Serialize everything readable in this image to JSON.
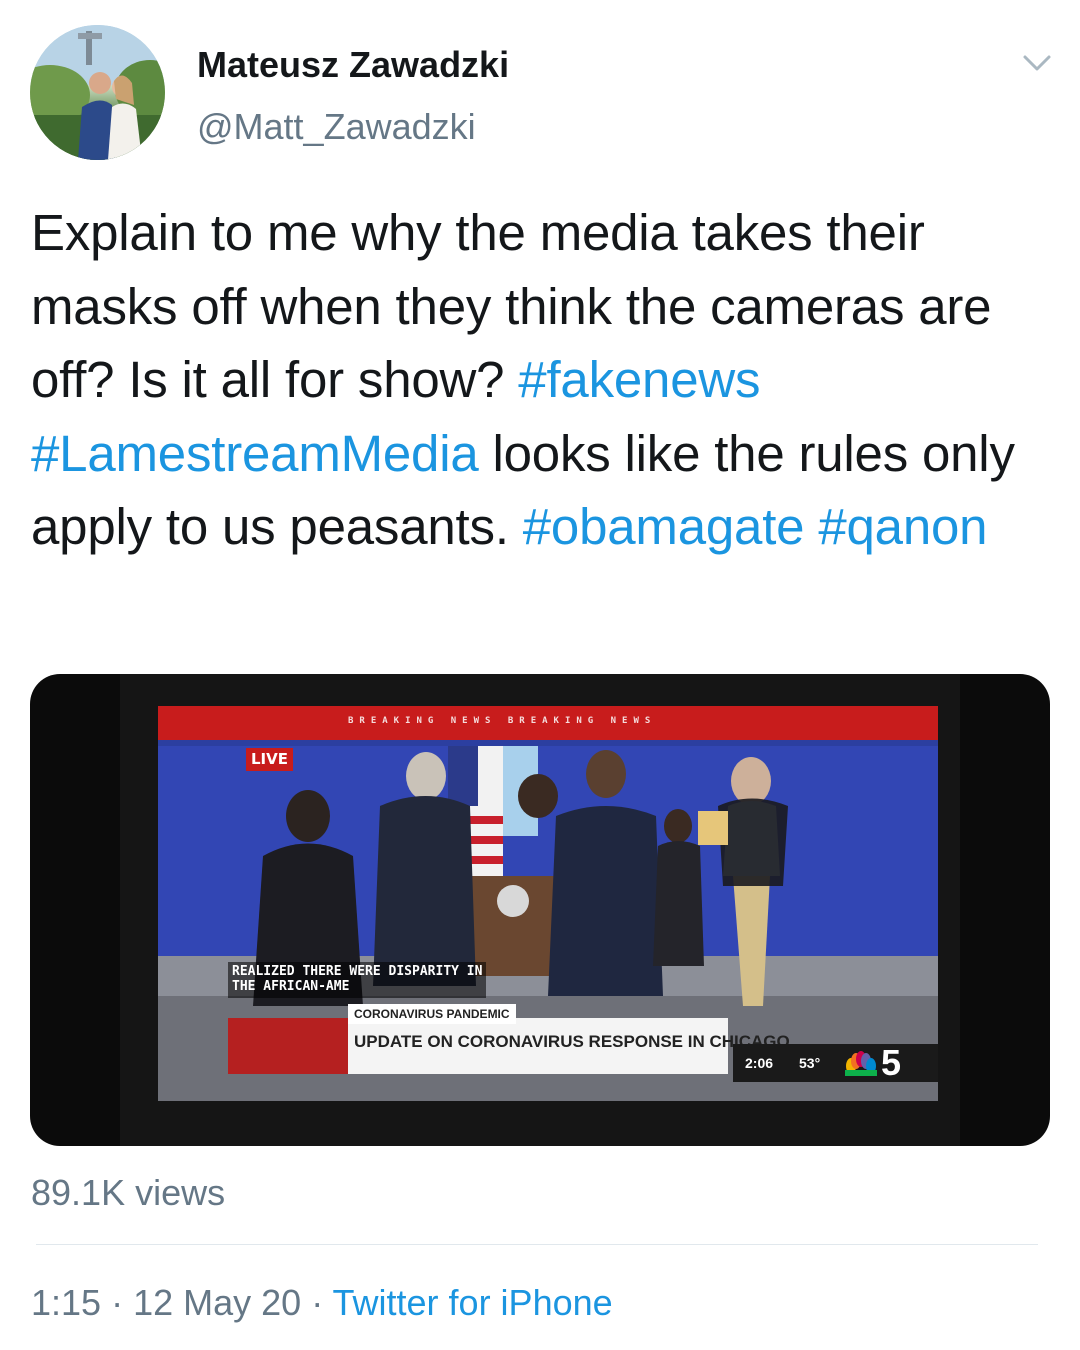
{
  "author": {
    "display_name": "Mateusz Zawadzki",
    "handle": "@Matt_Zawadzki",
    "avatar_icon": "profile-photo-couple"
  },
  "tweet": {
    "segments": [
      {
        "text": "Explain to me why the media takes their masks off when they think the cameras are off? Is it all for show? ",
        "type": "text"
      },
      {
        "text": "#fakenews",
        "type": "hashtag"
      },
      {
        "text": " ",
        "type": "text"
      },
      {
        "text": "#LamestreamMedia",
        "type": "hashtag"
      },
      {
        "text": " looks like the rules only apply to us peasants. ",
        "type": "text"
      },
      {
        "text": "#obamagate",
        "type": "hashtag"
      },
      {
        "text": " ",
        "type": "text"
      },
      {
        "text": "#qanon",
        "type": "hashtag"
      }
    ],
    "hashtag_color": "#1b95e0"
  },
  "media": {
    "banner": "BREAKING NEWS   BREAKING NEWS",
    "live_badge": "LIVE",
    "caption_line1": "REALIZED THERE WERE DISPARITY IN",
    "caption_line2": "THE AFRICAN-AME",
    "lower_third_kicker": "CORONAVIRUS PANDEMIC",
    "lower_third_headline": "UPDATE ON CORONAVIRUS RESPONSE IN CHICAGO",
    "clock": "2:06",
    "temperature": "53°",
    "channel_number": "5",
    "network_icon": "nbc-peacock-icon"
  },
  "stats": {
    "views": "89.1K views"
  },
  "footer": {
    "time": "1:15",
    "separator": " · ",
    "date": "12 May 20",
    "source": "Twitter for iPhone"
  },
  "colors": {
    "text": "#14171a",
    "secondary": "#657786",
    "link": "#1b95e0"
  }
}
